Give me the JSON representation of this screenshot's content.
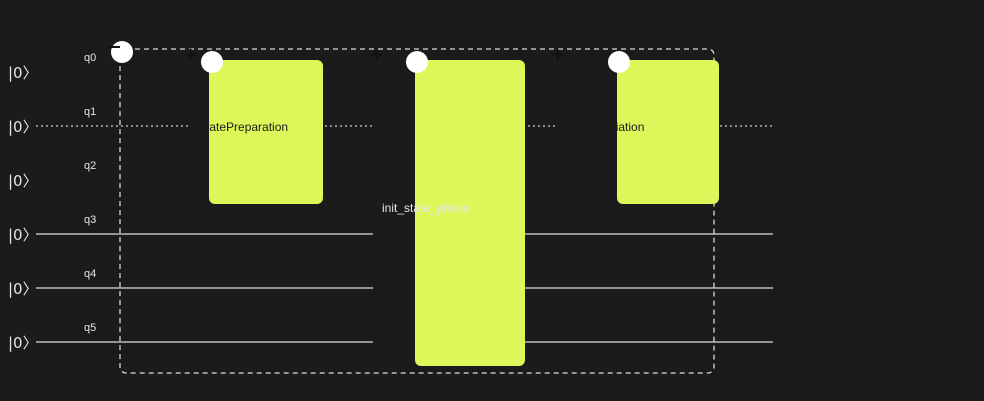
{
  "qubits": [
    {
      "ket": "|0〉",
      "label": "q0"
    },
    {
      "ket": "|0〉",
      "label": "q1"
    },
    {
      "ket": "|0〉",
      "label": "q2"
    },
    {
      "ket": "|0〉",
      "label": "q3"
    },
    {
      "ket": "|0〉",
      "label": "q4"
    },
    {
      "ket": "|0〉",
      "label": "q5"
    }
  ],
  "gates": [
    {
      "label": "StatePreparation"
    },
    {
      "label": "init_state_phase"
    },
    {
      "label": "Exponentiation"
    }
  ],
  "colors": {
    "background": "#1b1b1b",
    "gate_fill": "#dcf75a",
    "wire": "#bdbdbd",
    "control_dot": "#ffffff",
    "group_border": "#d9d9d9"
  },
  "icons": {
    "expand": "plus-icon",
    "collapse": "minus-icon",
    "control": "circle-icon"
  }
}
